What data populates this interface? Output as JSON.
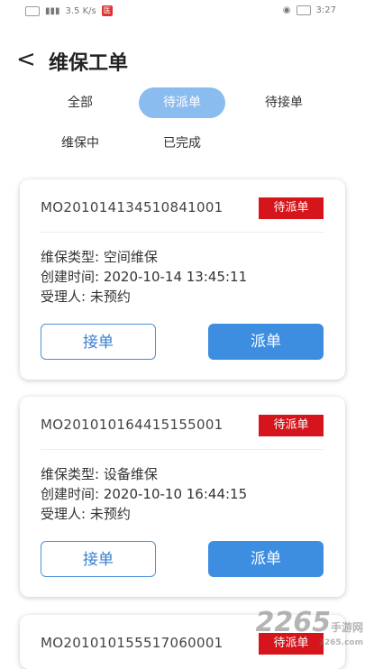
{
  "status_bar": {
    "speed": "3.5 K/s",
    "time": "3:27",
    "red_icon": "医"
  },
  "header": {
    "back_icon": "chevron-left-icon",
    "title": "维保工单"
  },
  "tabs": [
    {
      "label": "全部",
      "active": false
    },
    {
      "label": "待派单",
      "active": true
    },
    {
      "label": "待接单",
      "active": false
    },
    {
      "label": "维保中",
      "active": false
    },
    {
      "label": "已完成",
      "active": false
    }
  ],
  "orders": [
    {
      "order_no": "MO201014134510841001",
      "status": "待派单",
      "type": "维保类型: 空间维保",
      "created": "创建时间: 2020-10-14 13:45:11",
      "assignee": "受理人: 未预约",
      "accept_label": "接单",
      "dispatch_label": "派单"
    },
    {
      "order_no": "MO201010164415155001",
      "status": "待派单",
      "type": "维保类型: 设备维保",
      "created": "创建时间: 2020-10-10 16:44:15",
      "assignee": "受理人: 未预约",
      "accept_label": "接单",
      "dispatch_label": "派单"
    },
    {
      "order_no": "MO201010155517060001",
      "status": "待派单"
    }
  ],
  "watermark": {
    "main": "2265",
    "suffix": "手游网",
    "url": "2265.com"
  },
  "colors": {
    "accent": "#3d8ee0",
    "active_tab": "#8bbcf0",
    "badge": "#d5141b"
  }
}
